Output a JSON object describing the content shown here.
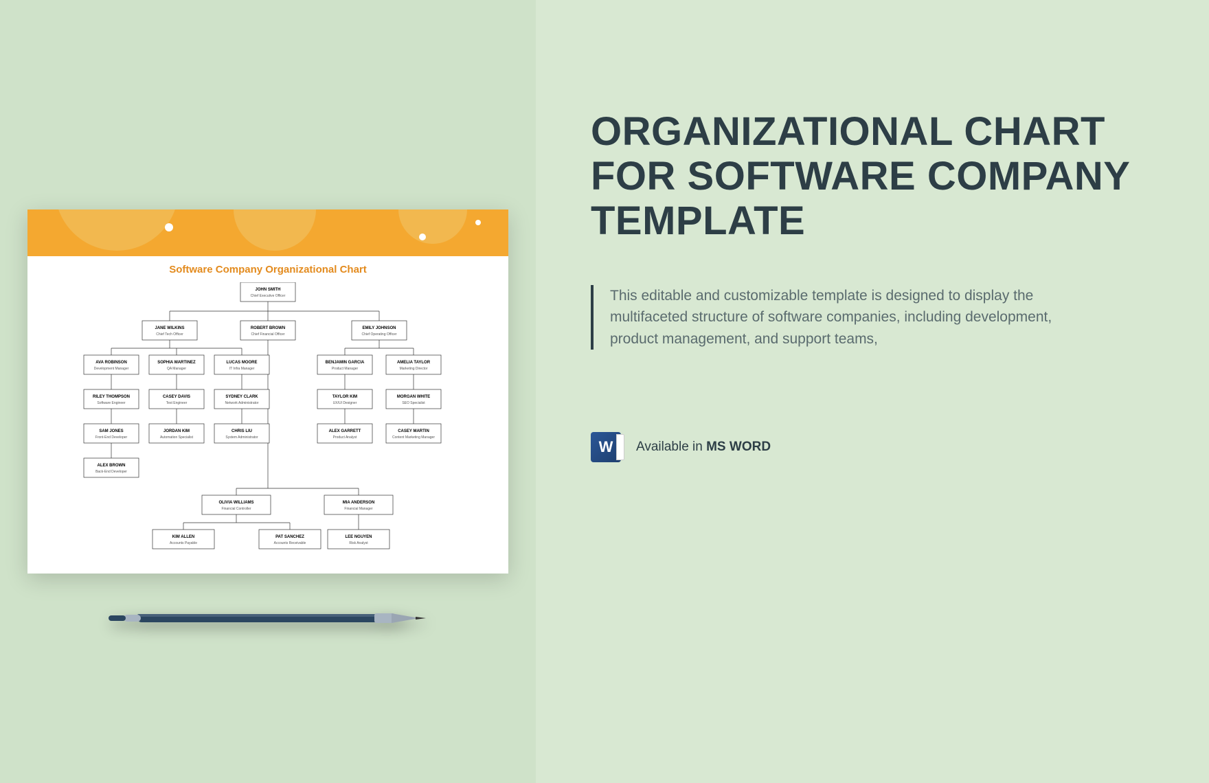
{
  "document": {
    "title": "Software Company Organizational Chart"
  },
  "org": {
    "ceo": {
      "name": "JOHN SMITH",
      "role": "Chief Executive Officer"
    },
    "cto": {
      "name": "JANE WILKINS",
      "role": "Chief Tech Officer"
    },
    "cfo": {
      "name": "ROBERT BROWN",
      "role": "Chief Financial Officer"
    },
    "coo": {
      "name": "EMILY JOHNSON",
      "role": "Chief Operating Officer"
    },
    "dev_mgr": {
      "name": "AVA ROBINSON",
      "role": "Development Manager"
    },
    "qa_mgr": {
      "name": "SOPHIA MARTINEZ",
      "role": "QA Manager"
    },
    "it_mgr": {
      "name": "LUCAS MOORE",
      "role": "IT Infra Manager"
    },
    "prod_mgr": {
      "name": "BENJAMIN GARCIA",
      "role": "Product Manager"
    },
    "mkt_dir": {
      "name": "AMELIA TAYLOR",
      "role": "Marketing Director"
    },
    "sw_eng": {
      "name": "RILEY THOMPSON",
      "role": "Software Engineer"
    },
    "test_eng": {
      "name": "CASEY DAVIS",
      "role": "Test Engineer"
    },
    "net_admin": {
      "name": "SYDNEY CLARK",
      "role": "Network Administrator"
    },
    "ux": {
      "name": "TAYLOR KIM",
      "role": "UX/UI Designer"
    },
    "seo": {
      "name": "MORGAN WHITE",
      "role": "SEO Specialist"
    },
    "fe_dev": {
      "name": "SAM JONES",
      "role": "Front-End Developer"
    },
    "auto": {
      "name": "JORDAN KIM",
      "role": "Automation Specialist"
    },
    "sys_admin": {
      "name": "CHRIS LIU",
      "role": "System Administrator"
    },
    "prod_analyst": {
      "name": "ALEX GARRETT",
      "role": "Product Analyst"
    },
    "content_mkt": {
      "name": "CASEY MARTIN",
      "role": "Content Marketing Manager"
    },
    "be_dev": {
      "name": "ALEX BROWN",
      "role": "Back-End Developer"
    },
    "fin_ctrl": {
      "name": "OLIVIA WILLIAMS",
      "role": "Financial Controller"
    },
    "fin_mgr": {
      "name": "MIA ANDERSON",
      "role": "Financial Manager"
    },
    "ap": {
      "name": "KIM ALLEN",
      "role": "Accounts Payable"
    },
    "ar": {
      "name": "PAT SANCHEZ",
      "role": "Accounts Receivable"
    },
    "risk": {
      "name": "LEE NGUYEN",
      "role": "Risk Analyst"
    }
  },
  "page": {
    "title": "ORGANIZATIONAL CHART FOR SOFTWARE COMPANY TEMPLATE",
    "description": "This editable and customizable template is designed to display the multifaceted structure of software companies, including development, product management, and support teams,",
    "availability_prefix": "Available in ",
    "availability_format": "MS WORD",
    "word_icon_letter": "W"
  }
}
